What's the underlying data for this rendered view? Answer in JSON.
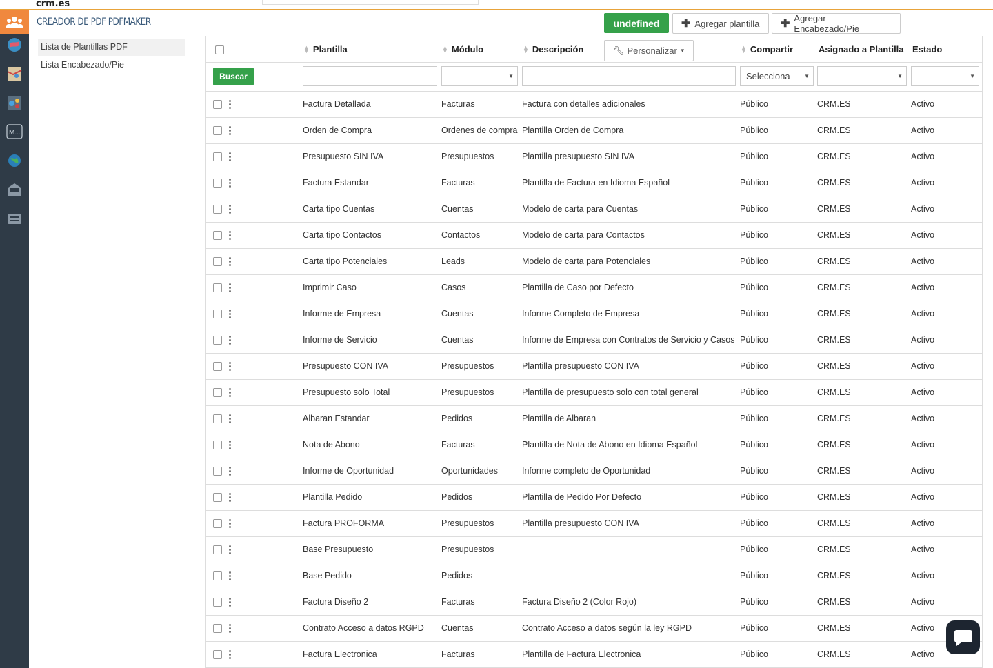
{
  "brand": "crm.es",
  "app_title": "CREADOR DE PDF PDFMAKER",
  "header": {
    "status_button": "undefined",
    "add_template": "Agregar plantilla",
    "add_header_footer": "Agregar Encabezado/Pie"
  },
  "sidebar": {
    "items": [
      {
        "label": "Lista de Plantillas PDF"
      },
      {
        "label": "Lista Encabezado/Pie"
      }
    ]
  },
  "rail_icons": [
    "users-icon",
    "globe-icon",
    "map-icon",
    "modules-icon",
    "mail-icon",
    "earth-icon",
    "inbox-icon",
    "list-icon"
  ],
  "table": {
    "columns": {
      "plantilla": "Plantilla",
      "modulo": "Módulo",
      "descripcion": "Descripción",
      "personalizar": "Personalizar",
      "compartir": "Compartir",
      "asignado": "Asignado a Plantilla",
      "estado": "Estado"
    },
    "search_button": "Buscar",
    "compartir_filter": "Selecciona",
    "rows": [
      {
        "plantilla": "Factura Detallada",
        "modulo": "Facturas",
        "descripcion": "Factura con detalles adicionales",
        "compartir": "Público",
        "asignado": "CRM.ES",
        "estado": "Activo"
      },
      {
        "plantilla": "Orden de Compra",
        "modulo": "Ordenes de compra",
        "descripcion": "Plantilla Orden de Compra",
        "compartir": "Público",
        "asignado": "CRM.ES",
        "estado": "Activo"
      },
      {
        "plantilla": "Presupuesto SIN IVA",
        "modulo": "Presupuestos",
        "descripcion": "Plantilla presupuesto SIN IVA",
        "compartir": "Público",
        "asignado": "CRM.ES",
        "estado": "Activo"
      },
      {
        "plantilla": "Factura Estandar",
        "modulo": "Facturas",
        "descripcion": "Plantilla de Factura en Idioma Español",
        "compartir": "Público",
        "asignado": "CRM.ES",
        "estado": "Activo"
      },
      {
        "plantilla": "Carta tipo Cuentas",
        "modulo": "Cuentas",
        "descripcion": "Modelo de carta para Cuentas",
        "compartir": "Público",
        "asignado": "CRM.ES",
        "estado": "Activo"
      },
      {
        "plantilla": "Carta tipo Contactos",
        "modulo": "Contactos",
        "descripcion": "Modelo de carta para Contactos",
        "compartir": "Público",
        "asignado": "CRM.ES",
        "estado": "Activo"
      },
      {
        "plantilla": "Carta tipo Potenciales",
        "modulo": "Leads",
        "descripcion": "Modelo de carta para Potenciales",
        "compartir": "Público",
        "asignado": "CRM.ES",
        "estado": "Activo"
      },
      {
        "plantilla": "Imprimir Caso",
        "modulo": "Casos",
        "descripcion": "Plantilla de Caso por Defecto",
        "compartir": "Público",
        "asignado": "CRM.ES",
        "estado": "Activo"
      },
      {
        "plantilla": "Informe de Empresa",
        "modulo": "Cuentas",
        "descripcion": "Informe Completo de Empresa",
        "compartir": "Público",
        "asignado": "CRM.ES",
        "estado": "Activo"
      },
      {
        "plantilla": "Informe de Servicio",
        "modulo": "Cuentas",
        "descripcion": "Informe de Empresa con Contratos de Servicio y Casos",
        "compartir": "Público",
        "asignado": "CRM.ES",
        "estado": "Activo"
      },
      {
        "plantilla": "Presupuesto CON IVA",
        "modulo": "Presupuestos",
        "descripcion": "Plantilla presupuesto CON IVA",
        "compartir": "Público",
        "asignado": "CRM.ES",
        "estado": "Activo"
      },
      {
        "plantilla": "Presupuesto solo Total",
        "modulo": "Presupuestos",
        "descripcion": "Plantilla de presupuesto solo con total general",
        "compartir": "Público",
        "asignado": "CRM.ES",
        "estado": "Activo"
      },
      {
        "plantilla": "Albaran Estandar",
        "modulo": "Pedidos",
        "descripcion": "Plantilla de Albaran",
        "compartir": "Público",
        "asignado": "CRM.ES",
        "estado": "Activo"
      },
      {
        "plantilla": "Nota de Abono",
        "modulo": "Facturas",
        "descripcion": "Plantilla de Nota de Abono en Idioma Español",
        "compartir": "Público",
        "asignado": "CRM.ES",
        "estado": "Activo"
      },
      {
        "plantilla": "Informe de Oportunidad",
        "modulo": "Oportunidades",
        "descripcion": "Informe completo de Oportunidad",
        "compartir": "Público",
        "asignado": "CRM.ES",
        "estado": "Activo"
      },
      {
        "plantilla": "Plantilla Pedido",
        "modulo": "Pedidos",
        "descripcion": "Plantilla de Pedido Por Defecto",
        "compartir": "Público",
        "asignado": "CRM.ES",
        "estado": "Activo"
      },
      {
        "plantilla": "Factura PROFORMA",
        "modulo": "Presupuestos",
        "descripcion": "Plantilla presupuesto CON IVA",
        "compartir": "Público",
        "asignado": "CRM.ES",
        "estado": "Activo"
      },
      {
        "plantilla": "Base Presupuesto",
        "modulo": "Presupuestos",
        "descripcion": "",
        "compartir": "Público",
        "asignado": "CRM.ES",
        "estado": "Activo"
      },
      {
        "plantilla": "Base Pedido",
        "modulo": "Pedidos",
        "descripcion": "",
        "compartir": "Público",
        "asignado": "CRM.ES",
        "estado": "Activo"
      },
      {
        "plantilla": "Factura Diseño 2",
        "modulo": "Facturas",
        "descripcion": "Factura Diseño 2 (Color Rojo)",
        "compartir": "Público",
        "asignado": "CRM.ES",
        "estado": "Activo"
      },
      {
        "plantilla": "Contrato Acceso a datos RGPD",
        "modulo": "Cuentas",
        "descripcion": "Contrato Acceso a datos según la ley RGPD",
        "compartir": "Público",
        "asignado": "CRM.ES",
        "estado": "Activo"
      },
      {
        "plantilla": "Factura Electronica",
        "modulo": "Facturas",
        "descripcion": "Plantilla de Factura Electronica",
        "compartir": "Público",
        "asignado": "CRM.ES",
        "estado": "Activo"
      }
    ]
  },
  "colors": {
    "accent_orange": "#f0883e",
    "rail_dark": "#2f3b47",
    "button_green": "#35a14a"
  }
}
